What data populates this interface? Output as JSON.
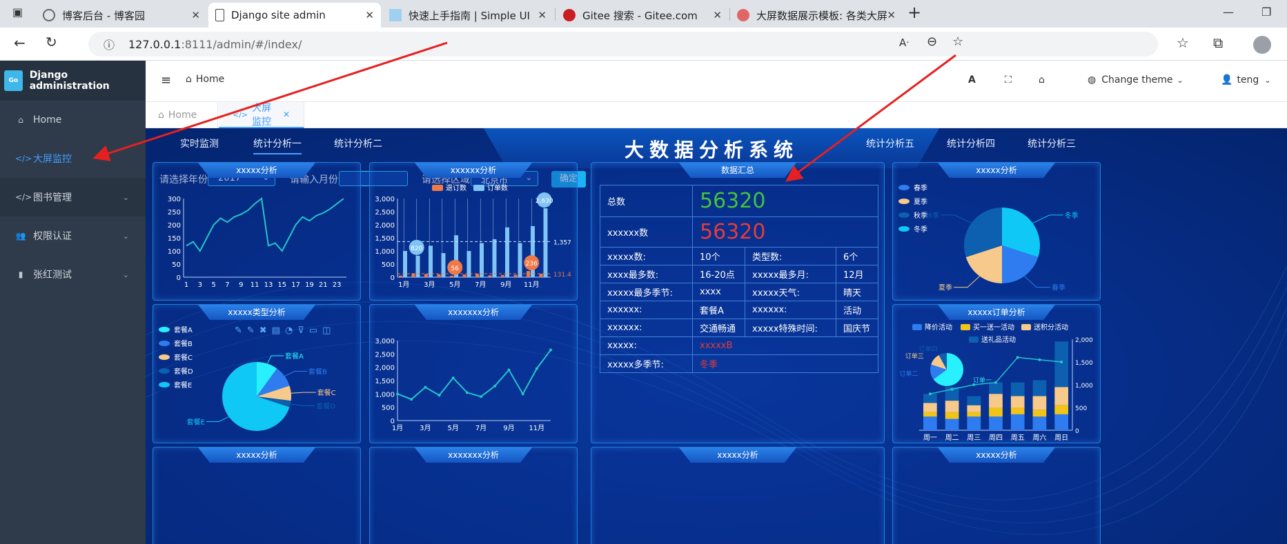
{
  "browser": {
    "tabs": [
      {
        "title": "博客后台 - 博客园"
      },
      {
        "title": "Django site admin"
      },
      {
        "title": "快速上手指南 | Simple UI"
      },
      {
        "title": "Gitee 搜索 - Gitee.com"
      },
      {
        "title": "大屏数据展示模板: 各类大屏展示"
      }
    ],
    "url_host": "127.0.0.1",
    "url_rest": ":8111/admin/#/index/"
  },
  "sidebar": {
    "brand": "Django administration",
    "items": [
      {
        "label": "Home",
        "icon": "home-icon"
      },
      {
        "label": "大屏监控",
        "icon": "code-icon"
      },
      {
        "label": "图书管理",
        "icon": "code-icon"
      },
      {
        "label": "权限认证",
        "icon": "users-cog-icon"
      },
      {
        "label": "张红测试",
        "icon": "file-icon"
      }
    ]
  },
  "topnav": {
    "breadcrumb": "Home",
    "theme_label": "Change theme",
    "user": "teng"
  },
  "page_tabs": [
    {
      "label": "Home"
    },
    {
      "label": "大屏监控"
    }
  ],
  "dashboard": {
    "title": "大数据分析系统",
    "nav_left": [
      "实时监测",
      "统计分析一",
      "统计分析二"
    ],
    "nav_right": [
      "统计分析五",
      "统计分析四",
      "统计分析三"
    ],
    "filters": {
      "year_label": "请选择年份:",
      "year_value": "2017",
      "month_label": "请输入月份:",
      "month_value": "",
      "region_label": "请选择区域:",
      "region_value": "北京市",
      "confirm": "确定"
    },
    "panels": {
      "p1": "xxxxx分析",
      "p2": "xxxxxx分析",
      "p3": "数据汇总",
      "p4": "xxxxx分析",
      "p5": "xxxxx类型分析",
      "p6": "xxxxxxx分析",
      "p7": "xxxxx订单分析",
      "b1": "xxxxx分析",
      "b2": "xxxxxxx分析",
      "b3": "xxxxx分析",
      "b4": "xxxxx分析"
    },
    "summary": {
      "total_label": "总数",
      "total_value": "56320",
      "count_label": "xxxxxx数",
      "count_value": "56320",
      "rows": [
        [
          "xxxxx数:",
          "10个",
          "类型数:",
          "6个"
        ],
        [
          "xxxx最多数:",
          "16-20点",
          "xxxxx最多月:",
          "12月"
        ],
        [
          "xxxxx最多季节:",
          "xxxx",
          "xxxxx天气:",
          "晴天"
        ],
        [
          "xxxxxx:",
          "套餐A",
          "xxxxxx:",
          "活动"
        ],
        [
          "xxxxxx:",
          "交通畅通",
          "xxxxx特殊时间:",
          "国庆节"
        ]
      ],
      "row_x_label": "xxxxx:",
      "row_x_value": "xxxxxB",
      "row_season_label": "xxxxx多季节:",
      "row_season_value": "冬季"
    }
  },
  "chart_data": [
    {
      "type": "line",
      "title": "xxxxx分析",
      "x": [
        1,
        2,
        3,
        4,
        5,
        6,
        7,
        8,
        9,
        10,
        11,
        12,
        13,
        14,
        15,
        16,
        17,
        18,
        19,
        20,
        21,
        22,
        23,
        24
      ],
      "x_ticks": [
        "1",
        "3",
        "5",
        "7",
        "9",
        "11",
        "13",
        "15",
        "17",
        "19",
        "21",
        "23"
      ],
      "values": [
        120,
        135,
        100,
        150,
        200,
        225,
        210,
        230,
        240,
        255,
        280,
        300,
        120,
        130,
        100,
        150,
        200,
        230,
        215,
        235,
        245,
        260,
        280,
        300
      ],
      "ylim": [
        0,
        300
      ],
      "y_ticks": [
        "0",
        "50",
        "100",
        "150",
        "200",
        "250",
        "300"
      ],
      "color": "#23c6c8"
    },
    {
      "type": "bar",
      "title": "xxxxxx分析",
      "categories": [
        "1月",
        "2月",
        "3月",
        "4月",
        "5月",
        "6月",
        "7月",
        "8月",
        "9月",
        "10月",
        "11月",
        "12月"
      ],
      "x_ticks": [
        "1月",
        "3月",
        "5月",
        "7月",
        "9月",
        "11月"
      ],
      "series": [
        {
          "name": "退订数",
          "values": [
            60,
            150,
            120,
            110,
            56,
            100,
            130,
            70,
            80,
            90,
            236,
            131.4
          ],
          "color": "#f0794a"
        },
        {
          "name": "订单数",
          "values": [
            1000,
            820,
            1200,
            920,
            1600,
            1000,
            1300,
            1450,
            1900,
            1300,
            1950,
            2630
          ],
          "color": "#7fc4f5"
        }
      ],
      "ylim": [
        0,
        3000
      ],
      "y_ticks": [
        "0",
        "500",
        "1,000",
        "1,500",
        "2,000",
        "2,500",
        "3,000"
      ],
      "markers": [
        {
          "label": "2,630"
        },
        {
          "label": "820"
        },
        {
          "label": "56"
        },
        {
          "label": "236"
        }
      ],
      "avg_line": {
        "value": 1357,
        "label": "1,357"
      },
      "avg_line2": {
        "value": 131.4,
        "label": "131.4"
      }
    },
    {
      "type": "pie",
      "title": "xxxxx分析",
      "legend": [
        "春季",
        "夏季",
        "秋季",
        "冬季"
      ],
      "slices": [
        {
          "name": "冬季",
          "value": 30,
          "color": "#10c8f5"
        },
        {
          "name": "春季",
          "value": 20,
          "color": "#2e7cf0"
        },
        {
          "name": "夏季",
          "value": 20,
          "color": "#f7c98b"
        },
        {
          "name": "秋季",
          "value": 30,
          "color": "#0d5fb0"
        }
      ]
    },
    {
      "type": "pie",
      "title": "xxxxx类型分析",
      "legend": [
        "套餐A",
        "套餐B",
        "套餐C",
        "套餐D",
        "套餐E"
      ],
      "slices": [
        {
          "name": "套餐A",
          "value": 10,
          "color": "#28f0ff"
        },
        {
          "name": "套餐B",
          "value": 10,
          "color": "#2e7cf0"
        },
        {
          "name": "套餐C",
          "value": 7,
          "color": "#f7c98b"
        },
        {
          "name": "套餐D",
          "value": 3,
          "color": "#0d5fb0"
        },
        {
          "name": "套餐E",
          "value": 70,
          "color": "#10c8f5"
        }
      ]
    },
    {
      "type": "line",
      "title": "xxxxxxx分析",
      "categories": [
        "1月",
        "2月",
        "3月",
        "4月",
        "5月",
        "6月",
        "7月",
        "8月",
        "9月",
        "10月",
        "11月",
        "12月"
      ],
      "x_ticks": [
        "1月",
        "3月",
        "5月",
        "7月",
        "9月",
        "11月"
      ],
      "values": [
        1000,
        800,
        1250,
        950,
        1600,
        1050,
        900,
        1300,
        1900,
        1000,
        1950,
        2650
      ],
      "ylim": [
        0,
        3000
      ],
      "y_ticks": [
        "0",
        "500",
        "1,000",
        "1,500",
        "2,000",
        "2,500",
        "3,000"
      ],
      "color": "#23c6c8"
    },
    {
      "type": "bar",
      "title": "xxxxx订单分析",
      "categories": [
        "周一",
        "周二",
        "周三",
        "周四",
        "周五",
        "周六",
        "周日"
      ],
      "legend": [
        "降价活动",
        "买一送一活动",
        "送积分活动",
        "送礼品活动"
      ],
      "series": [
        {
          "name": "降价活动",
          "values": [
            300,
            250,
            300,
            300,
            350,
            300,
            350
          ],
          "color": "#2e7cf0"
        },
        {
          "name": "买一送一活动",
          "values": [
            100,
            150,
            100,
            200,
            150,
            150,
            200
          ],
          "color": "#f0c419"
        },
        {
          "name": "送积分活动",
          "values": [
            200,
            250,
            150,
            300,
            250,
            300,
            400
          ],
          "color": "#f7c98b"
        },
        {
          "name": "送礼品活动",
          "values": [
            200,
            300,
            200,
            250,
            300,
            350,
            1000
          ],
          "color": "#0d5fb0"
        }
      ],
      "line_series": {
        "values": [
          800,
          900,
          1000,
          1050,
          1600,
          1550,
          1500
        ],
        "color": "#23c6c8"
      },
      "ylim": [
        0,
        2000
      ],
      "y_ticks": [
        "0",
        "500",
        "1,000",
        "1,500",
        "2,000"
      ],
      "inner_pie": [
        {
          "name": "订单一",
          "value": 65,
          "color": "#28f0ff"
        },
        {
          "name": "订单二",
          "value": 15,
          "color": "#2e7cf0"
        },
        {
          "name": "订单三",
          "value": 12,
          "color": "#f7c98b"
        },
        {
          "name": "订单四",
          "value": 8,
          "color": "#0d5fb0"
        }
      ]
    }
  ]
}
